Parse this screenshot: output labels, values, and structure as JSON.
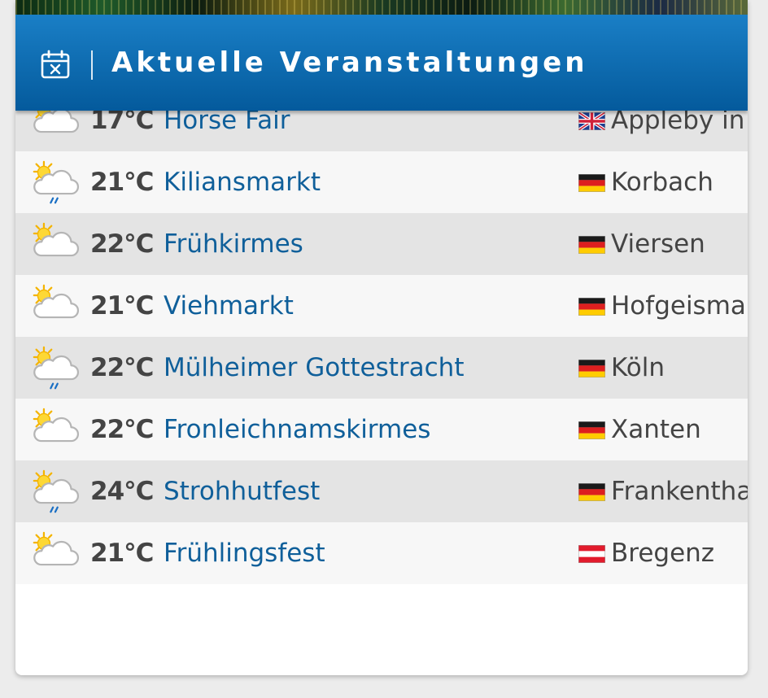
{
  "header": {
    "title": "Aktuelle Veranstaltungen",
    "icon": "calendar-x-icon",
    "gradient_top": "#1a7fc6",
    "gradient_bottom": "#045a9c"
  },
  "colors": {
    "event_link": "#0f5f9a",
    "temperature": "#444444",
    "row_dark": "#e4e4e4",
    "row_light": "#f7f7f7"
  },
  "events": [
    {
      "weather": "partly-cloudy-icon",
      "temperature": "17°C",
      "name": "Horse Fair",
      "country": "uk",
      "location": "Appleby in"
    },
    {
      "weather": "partly-cloudy-rain-icon",
      "temperature": "21°C",
      "name": "Kiliansmarkt",
      "country": "de",
      "location": "Korbach"
    },
    {
      "weather": "partly-cloudy-icon",
      "temperature": "22°C",
      "name": "Frühkirmes",
      "country": "de",
      "location": "Viersen"
    },
    {
      "weather": "partly-cloudy-icon",
      "temperature": "21°C",
      "name": "Viehmarkt",
      "country": "de",
      "location": "Hofgeismar"
    },
    {
      "weather": "partly-cloudy-rain-icon",
      "temperature": "22°C",
      "name": "Mülheimer Gottestracht",
      "country": "de",
      "location": "Köln"
    },
    {
      "weather": "partly-cloudy-icon",
      "temperature": "22°C",
      "name": "Fronleichnamskirmes",
      "country": "de",
      "location": "Xanten"
    },
    {
      "weather": "partly-cloudy-rain-icon",
      "temperature": "24°C",
      "name": "Strohhutfest",
      "country": "de",
      "location": "Frankenthal"
    },
    {
      "weather": "partly-cloudy-icon",
      "temperature": "21°C",
      "name": "Frühlingsfest",
      "country": "at",
      "location": "Bregenz"
    }
  ]
}
